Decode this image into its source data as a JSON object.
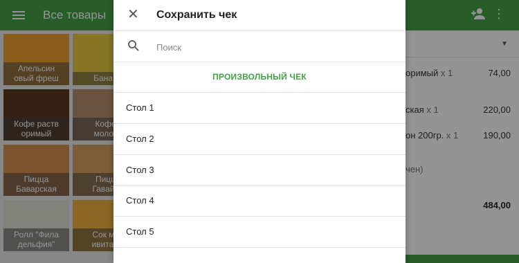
{
  "topbar": {
    "title": "Все товары",
    "menu_icon": "menu-icon",
    "add_person_icon": "person-add-icon",
    "more_icon": "more-vert-icon"
  },
  "products": [
    {
      "name": "Апельсиновый фреш",
      "label": "Апельсин\nовый фреш",
      "color": "#f0a030"
    },
    {
      "name": "Банан",
      "label": "Банан",
      "color": "#e8c840"
    },
    {
      "name": "Кофе растворимый",
      "label": "Кофе раств\nоримый",
      "color": "#5a3a22"
    },
    {
      "name": "Кофе с молоком",
      "label": "Кофе\nмолок",
      "color": "#b89070"
    },
    {
      "name": "Пицца Баварская",
      "label": "Пицца\nБаварская",
      "color": "#d89050"
    },
    {
      "name": "Пицца Гавайская",
      "label": "Пицц\nГавайс",
      "color": "#d8a060"
    },
    {
      "name": "Ролл Филадельфия",
      "label": "Ролл \"Фила\nдельфия\"",
      "color": "#e0e0d8"
    },
    {
      "name": "Сок мультивитаминный",
      "label": "Сок му\nивитам",
      "color": "#f0b040"
    }
  ],
  "cart": {
    "items": [
      {
        "name": "оримый",
        "qty": "x 1",
        "price": "74,00"
      },
      {
        "name": "ская",
        "qty": "x 1",
        "price": "220,00"
      },
      {
        "name": "он 200гр.",
        "qty": "x 1",
        "price": "190,00"
      }
    ],
    "note": "чен)",
    "total": "484,00",
    "accent": "#43a047"
  },
  "dialog": {
    "title": "Сохранить чек",
    "close_icon": "close-icon",
    "search_icon": "search-icon",
    "search_placeholder": "Поиск",
    "search_value": "",
    "custom_check_label": "ПРОИЗВОЛЬНЫЙ ЧЕК",
    "tables": [
      "Стол 1",
      "Стол 2",
      "Стол 3",
      "Стол 4",
      "Стол 5"
    ]
  }
}
